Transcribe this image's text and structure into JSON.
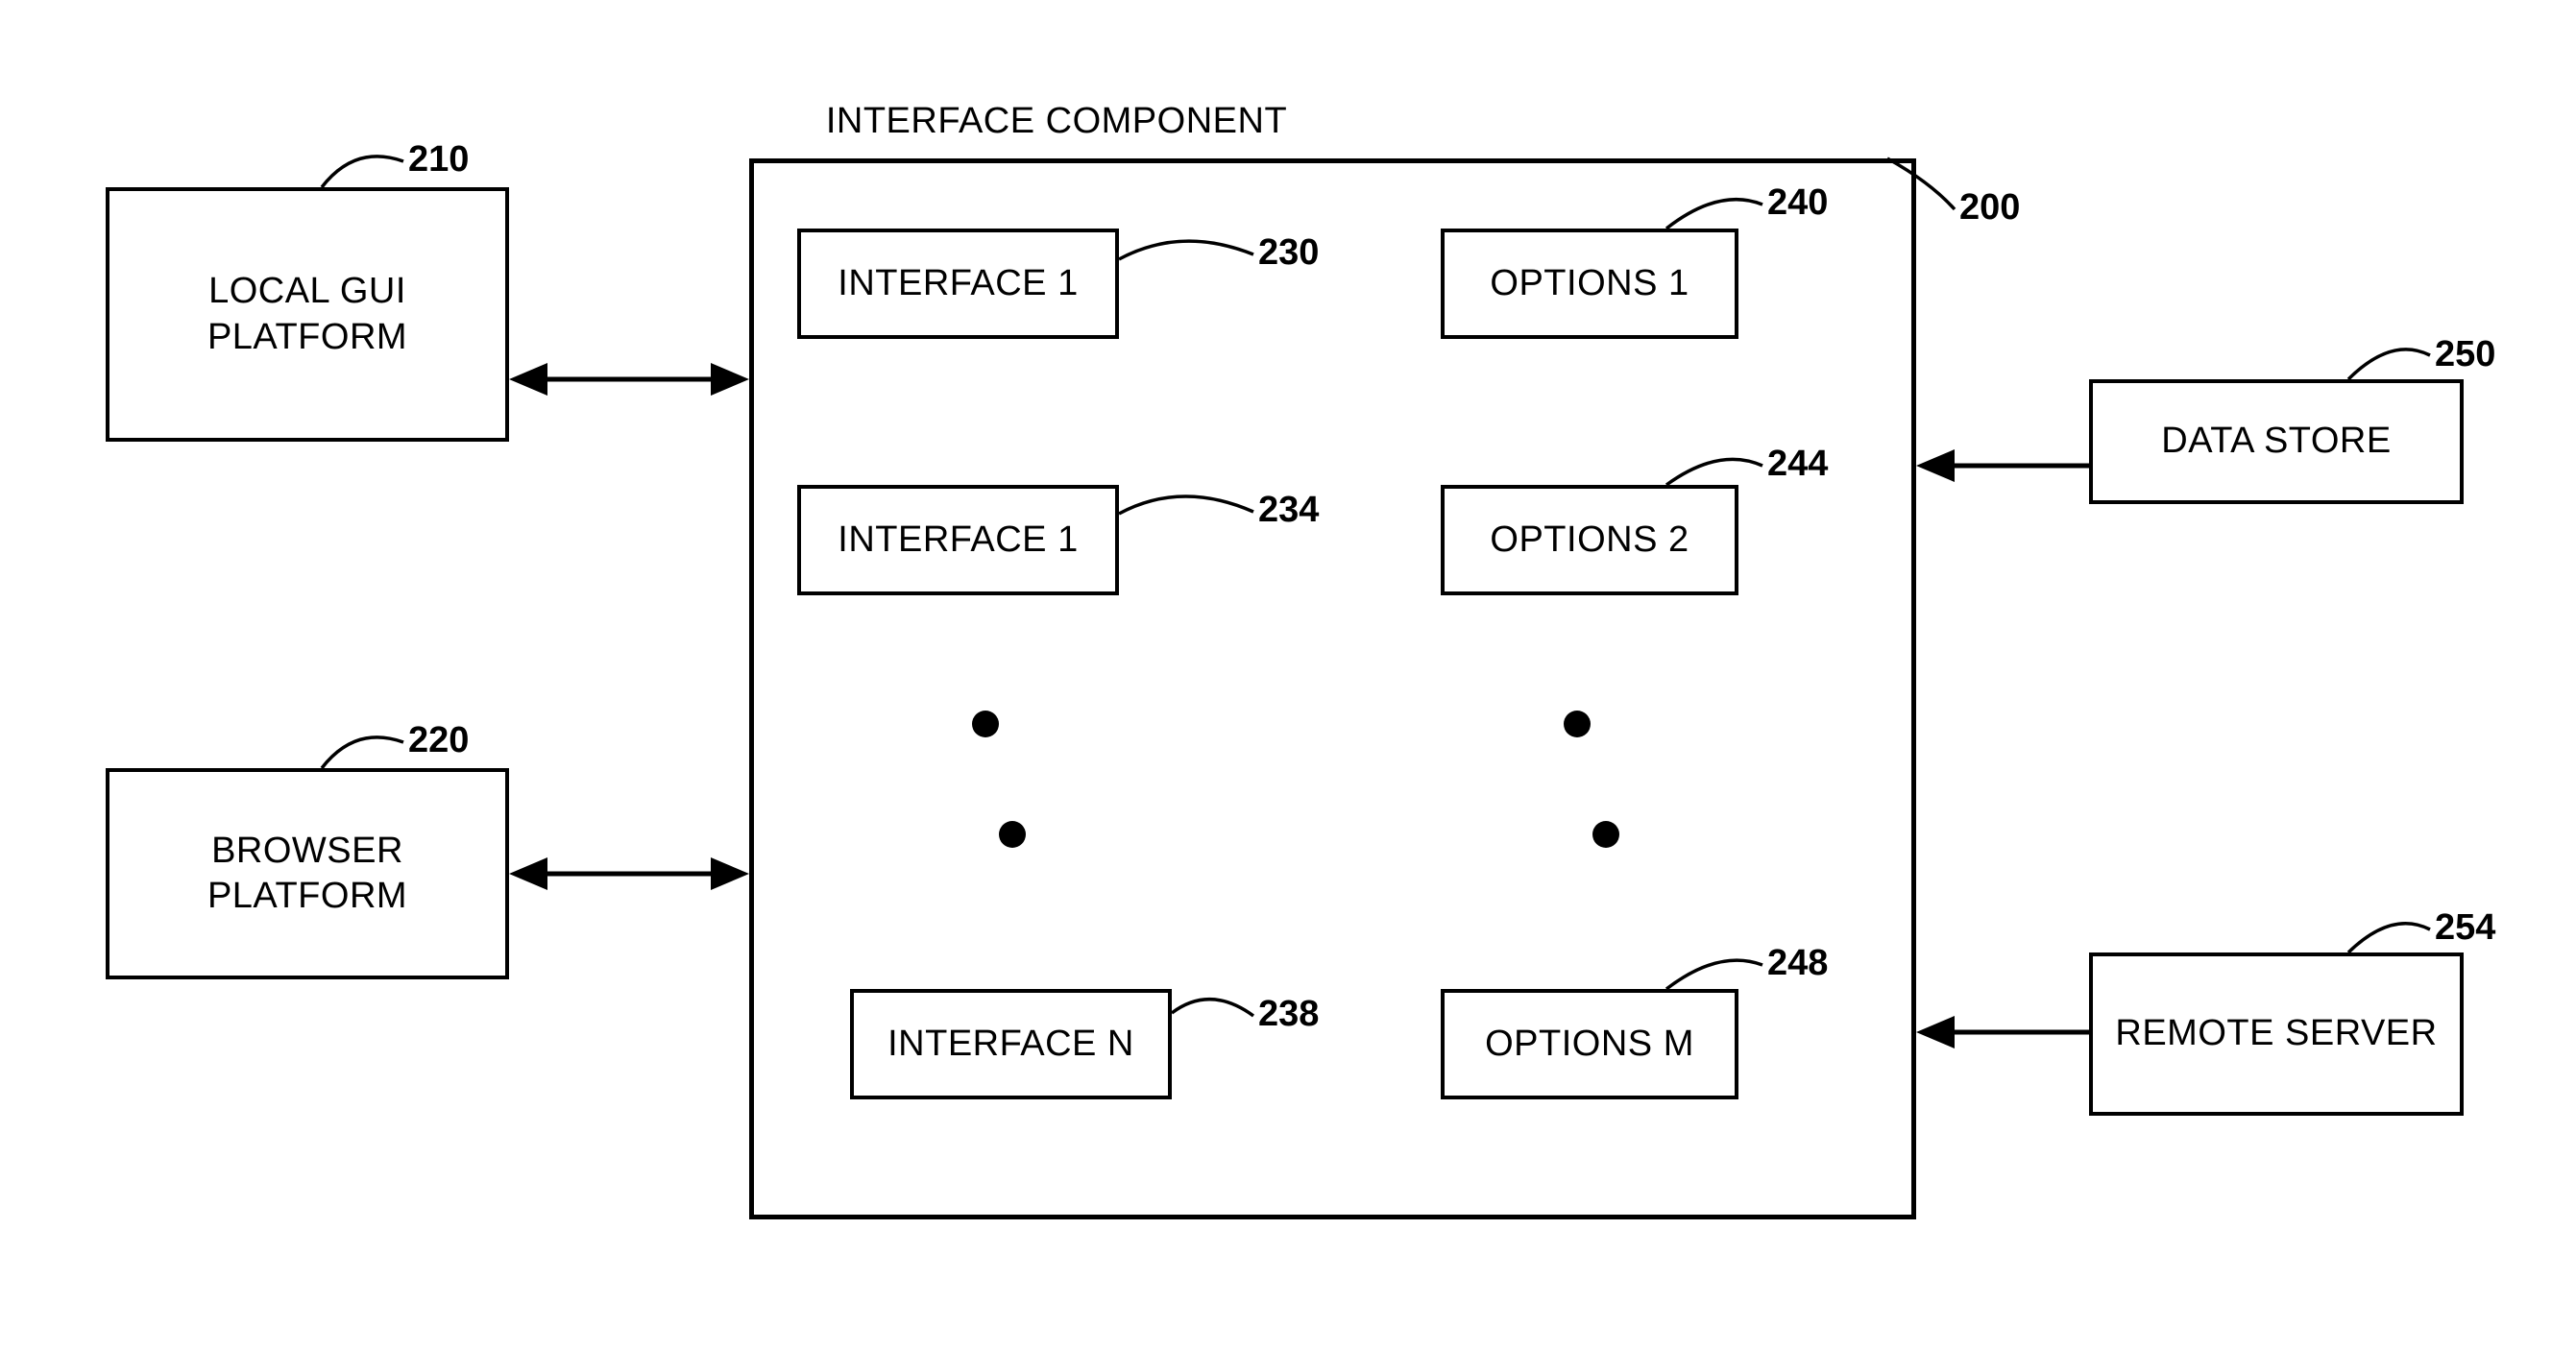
{
  "title": "INTERFACE COMPONENT",
  "blocks": {
    "local_gui": {
      "label": "LOCAL GUI PLATFORM",
      "ref": "210"
    },
    "browser": {
      "label": "BROWSER PLATFORM",
      "ref": "220"
    },
    "interface_comp": {
      "ref": "200"
    },
    "interface1": {
      "label": "INTERFACE 1",
      "ref": "230"
    },
    "interface2": {
      "label": "INTERFACE 1",
      "ref": "234"
    },
    "interfaceN": {
      "label": "INTERFACE N",
      "ref": "238"
    },
    "options1": {
      "label": "OPTIONS 1",
      "ref": "240"
    },
    "options2": {
      "label": "OPTIONS 2",
      "ref": "244"
    },
    "optionsM": {
      "label": "OPTIONS M",
      "ref": "248"
    },
    "datastore": {
      "label": "DATA STORE",
      "ref": "250"
    },
    "remoteserver": {
      "label": "REMOTE SERVER",
      "ref": "254"
    }
  }
}
